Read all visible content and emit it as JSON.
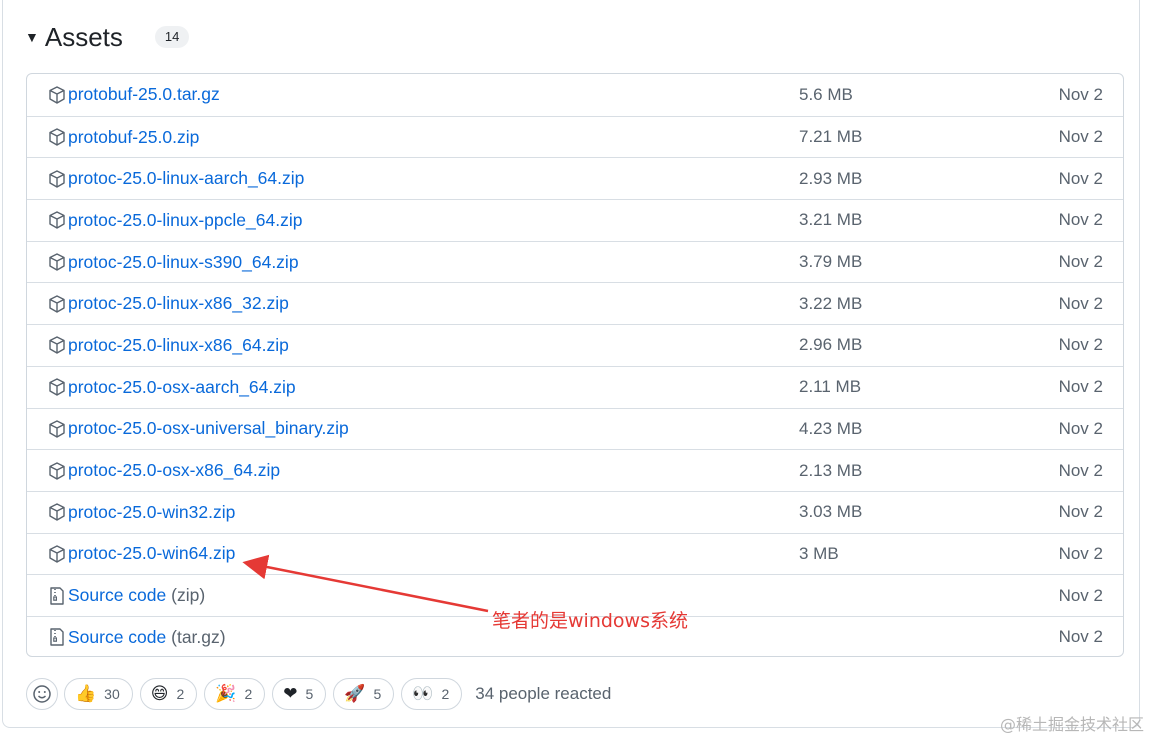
{
  "header": {
    "title": "Assets",
    "count": "14"
  },
  "assets": [
    {
      "kind": "package",
      "name": "protobuf-25.0.tar.gz",
      "suffix": "",
      "size": "5.6 MB",
      "date": "Nov 2"
    },
    {
      "kind": "package",
      "name": "protobuf-25.0.zip",
      "suffix": "",
      "size": "7.21 MB",
      "date": "Nov 2"
    },
    {
      "kind": "package",
      "name": "protoc-25.0-linux-aarch_64.zip",
      "suffix": "",
      "size": "2.93 MB",
      "date": "Nov 2"
    },
    {
      "kind": "package",
      "name": "protoc-25.0-linux-ppcle_64.zip",
      "suffix": "",
      "size": "3.21 MB",
      "date": "Nov 2"
    },
    {
      "kind": "package",
      "name": "protoc-25.0-linux-s390_64.zip",
      "suffix": "",
      "size": "3.79 MB",
      "date": "Nov 2"
    },
    {
      "kind": "package",
      "name": "protoc-25.0-linux-x86_32.zip",
      "suffix": "",
      "size": "3.22 MB",
      "date": "Nov 2"
    },
    {
      "kind": "package",
      "name": "protoc-25.0-linux-x86_64.zip",
      "suffix": "",
      "size": "2.96 MB",
      "date": "Nov 2"
    },
    {
      "kind": "package",
      "name": "protoc-25.0-osx-aarch_64.zip",
      "suffix": "",
      "size": "2.11 MB",
      "date": "Nov 2"
    },
    {
      "kind": "package",
      "name": "protoc-25.0-osx-universal_binary.zip",
      "suffix": "",
      "size": "4.23 MB",
      "date": "Nov 2"
    },
    {
      "kind": "package",
      "name": "protoc-25.0-osx-x86_64.zip",
      "suffix": "",
      "size": "2.13 MB",
      "date": "Nov 2"
    },
    {
      "kind": "package",
      "name": "protoc-25.0-win32.zip",
      "suffix": "",
      "size": "3.03 MB",
      "date": "Nov 2"
    },
    {
      "kind": "package",
      "name": "protoc-25.0-win64.zip",
      "suffix": "",
      "size": "3 MB",
      "date": "Nov 2"
    },
    {
      "kind": "zip",
      "name": "Source code",
      "suffix": " (zip)",
      "size": "",
      "date": "Nov 2"
    },
    {
      "kind": "zip",
      "name": "Source code",
      "suffix": " (tar.gz)",
      "size": "",
      "date": "Nov 2"
    }
  ],
  "annotation": {
    "text": "笔者的是windows系统",
    "color": "#e53935"
  },
  "reactions": {
    "items": [
      {
        "icon": "thumbs-up-icon",
        "emoji": "👍",
        "count": "30"
      },
      {
        "icon": "laugh-icon",
        "emoji": "😄",
        "count": "2"
      },
      {
        "icon": "hooray-icon",
        "emoji": "🎉",
        "count": "2"
      },
      {
        "icon": "heart-icon",
        "emoji": "❤",
        "count": "5"
      },
      {
        "icon": "rocket-icon",
        "emoji": "🚀",
        "count": "5"
      },
      {
        "icon": "eyes-icon",
        "emoji": "👀",
        "count": "2"
      }
    ],
    "summary": "34 people reacted"
  },
  "watermark": "@稀土掘金技术社区",
  "colors": {
    "link": "#0969da",
    "muted": "#59636e",
    "border": "#d0d7de"
  }
}
